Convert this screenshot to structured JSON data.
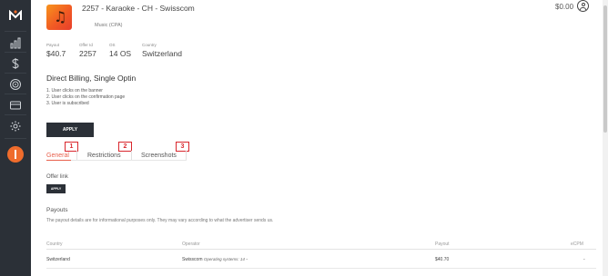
{
  "sidebar": {
    "logo": "M",
    "items": [
      {
        "icon": "bar-chart-icon"
      },
      {
        "icon": "dollar-icon"
      },
      {
        "icon": "target-icon"
      },
      {
        "icon": "credit-card-icon"
      },
      {
        "icon": "gear-icon"
      }
    ],
    "alert_color": "#ef6c2c"
  },
  "header": {
    "title": "2257 - Karaoke - CH - Swisscom",
    "subtitle": "Music (CPA)",
    "balance": "$0.00"
  },
  "stats": [
    {
      "label": "Payout",
      "value": "$40.7"
    },
    {
      "label": "Offer Id",
      "value": "2257"
    },
    {
      "label": "OS",
      "value": "14 OS"
    },
    {
      "label": "Country",
      "value": "Switzerland"
    }
  ],
  "flow": {
    "title": "Direct Billing, Single Optin",
    "steps": [
      "1. User clicks on the banner",
      "2. User clicks on the confirmation page",
      "3. User is subscribed"
    ],
    "apply_label": "APPLY"
  },
  "tabs": [
    {
      "label": "General",
      "marker": "1"
    },
    {
      "label": "Restrictions",
      "marker": "2"
    },
    {
      "label": "Screenshots",
      "marker": "3"
    }
  ],
  "offer_link": {
    "label": "Offer link",
    "apply_label": "APPLY"
  },
  "payouts": {
    "title": "Payouts",
    "note": "The payout details are for informational purposes only. They may vary according to what the advertiser sends us.",
    "columns": [
      "Country",
      "Operator",
      "Payout",
      "eCPM"
    ],
    "rows": [
      {
        "country": "Switzerland",
        "operator": "Swisscom",
        "os": "Operating systems: 14",
        "os_more": "-",
        "payout": "$40.70",
        "ecpm": "-"
      }
    ]
  },
  "colors": {
    "sidebar": "#2b3037",
    "accent": "#e8604c",
    "marker": "#d9262c"
  }
}
